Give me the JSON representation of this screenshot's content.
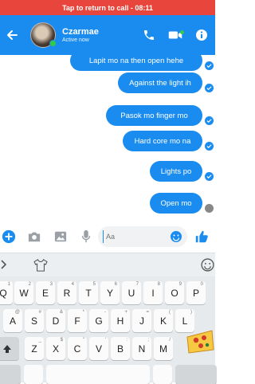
{
  "call_bar": {
    "text": "Tap to return to call - 08:11"
  },
  "header": {
    "name": "Czarmae",
    "status": "Active now",
    "colors": {
      "brand": "#1a8cf0",
      "online": "#31cc46",
      "call_bar": "#e8453c"
    }
  },
  "messages": [
    {
      "text": "Lapit mo na then open hehe"
    },
    {
      "text": "Against the light ih"
    },
    {
      "text": "Pasok mo finger mo"
    },
    {
      "text": "Hard core mo na"
    },
    {
      "text": "Lights po"
    },
    {
      "text": "Open mo"
    }
  ],
  "composer": {
    "placeholder": "Aa"
  },
  "keyboard": {
    "row1": [
      {
        "key": "Q",
        "sub": "1"
      },
      {
        "key": "W",
        "sub": "2"
      },
      {
        "key": "E",
        "sub": "3"
      },
      {
        "key": "R",
        "sub": "4"
      },
      {
        "key": "T",
        "sub": "5"
      },
      {
        "key": "Y",
        "sub": "6"
      },
      {
        "key": "U",
        "sub": "7"
      },
      {
        "key": "I",
        "sub": "8"
      },
      {
        "key": "O",
        "sub": "9"
      },
      {
        "key": "P",
        "sub": "0"
      }
    ],
    "row2": [
      {
        "key": "A",
        "sub": "@"
      },
      {
        "key": "S",
        "sub": "#"
      },
      {
        "key": "D",
        "sub": "&"
      },
      {
        "key": "F",
        "sub": "*"
      },
      {
        "key": "G",
        "sub": "-"
      },
      {
        "key": "H",
        "sub": "+"
      },
      {
        "key": "J",
        "sub": "="
      },
      {
        "key": "K",
        "sub": "("
      },
      {
        "key": "L",
        "sub": ")"
      }
    ],
    "row3": [
      {
        "key": "Z",
        "sub": "_"
      },
      {
        "key": "X",
        "sub": "$"
      },
      {
        "key": "C",
        "sub": "\""
      },
      {
        "key": "V",
        "sub": "'"
      },
      {
        "key": "B",
        "sub": ":"
      },
      {
        "key": "N",
        "sub": ";"
      },
      {
        "key": "M",
        "sub": "/"
      }
    ]
  }
}
